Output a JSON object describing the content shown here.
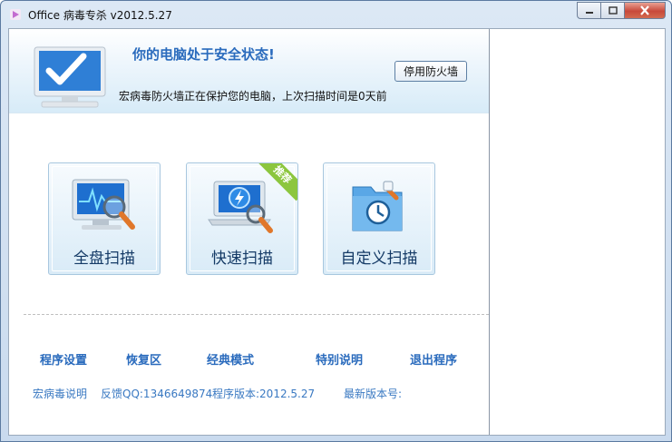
{
  "window": {
    "title": "Office 病毒专杀 v2012.5.27"
  },
  "banner": {
    "status": "你的电脑处于安全状态!",
    "firewall_button": "停用防火墙",
    "protect_info": "宏病毒防火墙正在保护您的电脑，上次扫描时间是0天前"
  },
  "scan_buttons": [
    {
      "label": "全盘扫描",
      "icon": "full-scan-monitor-icon"
    },
    {
      "label": "快速扫描",
      "icon": "quick-scan-laptop-icon",
      "badge": "推荐"
    },
    {
      "label": "自定义扫描",
      "icon": "custom-scan-folder-icon"
    }
  ],
  "links": [
    {
      "label": "程序设置"
    },
    {
      "label": "恢复区"
    },
    {
      "label": "经典模式"
    },
    {
      "label": "特别说明"
    },
    {
      "label": "退出程序"
    }
  ],
  "footer": {
    "about": "宏病毒说明",
    "feedback": "反馈QQ:1346649874",
    "version": "程序版本:2012.5.27",
    "latest": "最新版本号:"
  },
  "colors": {
    "accent": "#2a6bbd",
    "badge": "#8cc63e",
    "check": "#2f7fd6"
  }
}
